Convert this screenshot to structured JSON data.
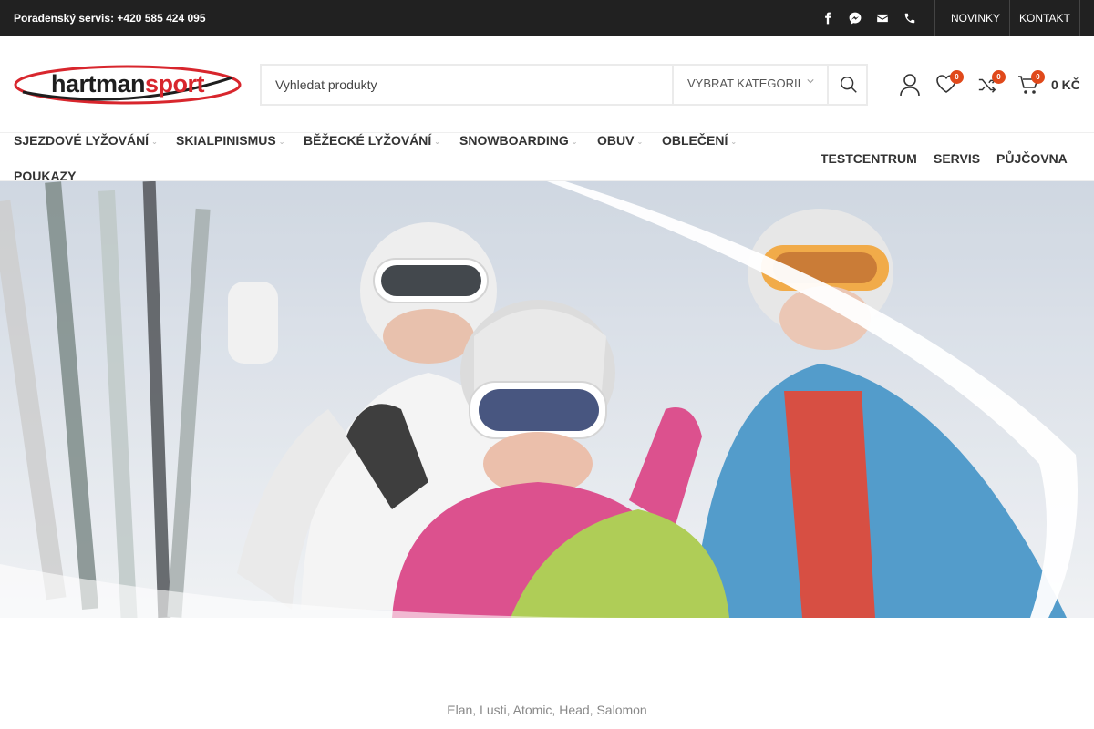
{
  "topbar": {
    "hotline": "Poradenský servis: +420 585 424 095",
    "socials": [
      "facebook-icon",
      "messenger-icon",
      "email-icon",
      "phone-icon"
    ],
    "links": [
      "NOVINKY",
      "KONTAKT"
    ]
  },
  "header": {
    "logo_text": "hartmansport",
    "search_placeholder": "Vyhledat produkty",
    "category_label": "VYBRAT KATEGORII",
    "wishlist_count": "0",
    "compare_count": "0",
    "cart_count": "0",
    "cart_total": "0 KČ"
  },
  "nav": {
    "main": [
      {
        "label": "SJEZDOVÉ LYŽOVÁNÍ"
      },
      {
        "label": "SKIALPINISMUS"
      },
      {
        "label": "BĚŽECKÉ LYŽOVÁNÍ"
      },
      {
        "label": "SNOWBOARDING"
      },
      {
        "label": "OBUV"
      },
      {
        "label": "OBLEČENÍ"
      },
      {
        "label": "POUKAZY"
      }
    ],
    "secondary": [
      "TESTCENTRUM",
      "SERVIS",
      "PŮJČOVNA"
    ]
  },
  "colors": {
    "topbar_bg": "#212121",
    "badge": "#e0491b",
    "logo_red": "#d8262d",
    "logo_dark": "#1e1e1e"
  },
  "brands_line": "Elan, Lusti, Atomic, Head, Salomon"
}
